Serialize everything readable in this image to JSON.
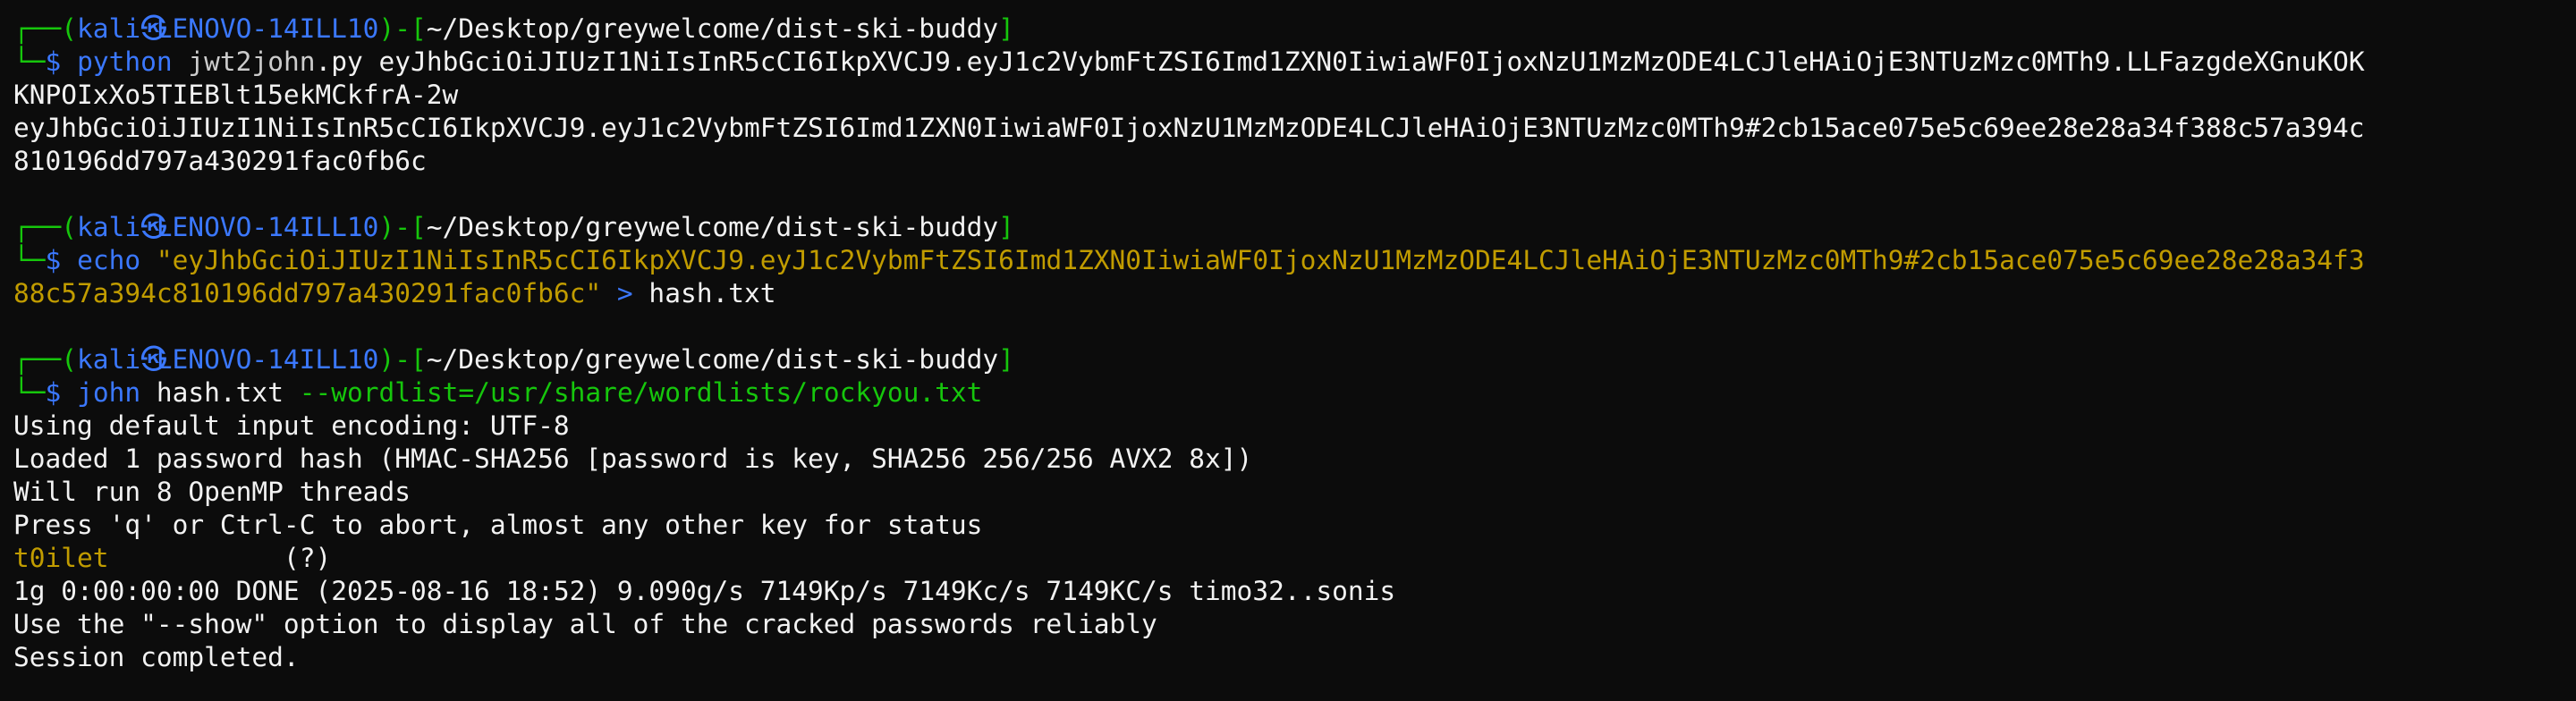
{
  "colors": {
    "background": "#0c0c0c",
    "foreground": "#cccccc",
    "prompt_frame": "#16c60c",
    "user_host": "#3b78ff",
    "command": "#3b78ff",
    "string": "#c19c00",
    "path": "#f2f2f2"
  },
  "prompt": {
    "frame_top": "┌──(",
    "user": "kali",
    "icon": "㉿",
    "host": "LENOVO-14ILL10",
    "mid": ")-[",
    "cwd": "~/Desktop/greywelcome/dist-ski-buddy",
    "end": "]",
    "frame_bottom": "└─",
    "dollar": "$ "
  },
  "block1": {
    "command": "python",
    "args_white": " jwt2john",
    "args_ext": ".py eyJhbGciOiJIUzI1NiIsInR5cCI6IkpXVCJ9.eyJ1c2VybmFtZSI6Imd1ZXN0IiwiaWF0IjoxNzU1MzMzODE4LCJleHAiOjE3NTUzMzc0MTh9.LLFazgdeXGnuKOK",
    "args_wrap": "KNPOIxXo5TIEBlt15ekMCkfrA-2w",
    "output": [
      "eyJhbGciOiJIUzI1NiIsInR5cCI6IkpXVCJ9.eyJ1c2VybmFtZSI6Imd1ZXN0IiwiaWF0IjoxNzU1MzMzODE4LCJleHAiOjE3NTUzMzc0MTh9#2cb15ace075e5c69ee28e28a34f388c57a394c",
      "810196dd797a430291fac0fb6c"
    ]
  },
  "block2": {
    "command": "echo",
    "string_part1": " \"eyJhbGciOiJIUzI1NiIsInR5cCI6IkpXVCJ9.eyJ1c2VybmFtZSI6Imd1ZXN0IiwiaWF0IjoxNzU1MzMzODE4LCJleHAiOjE3NTUzMzc0MTh9#2cb15ace075e5c69ee28e28a34f3",
    "string_part2": "88c57a394c810196dd797a430291fac0fb6c\"",
    "redirect": " >",
    "file": " hash.txt"
  },
  "block3": {
    "command": "john",
    "file": " hash.txt",
    "option": " --wordlist=/usr/share/wordlists/rockyou.txt",
    "output_before": [
      "Using default input encoding: UTF-8",
      "Loaded 1 password hash (HMAC-SHA256 [password is key, SHA256 256/256 AVX2 8x])",
      "Will run 8 OpenMP threads",
      "Press 'q' or Ctrl-C to abort, almost any other key for status"
    ],
    "cracked_password": "t0ilet",
    "cracked_gap": "           ",
    "cracked_label": "(?)",
    "output_after": [
      "1g 0:00:00:00 DONE (2025-08-16 18:52) 9.090g/s 7149Kp/s 7149Kc/s 7149KC/s timo32..sonis",
      "Use the \"--show\" option to display all of the cracked passwords reliably",
      "Session completed."
    ]
  }
}
